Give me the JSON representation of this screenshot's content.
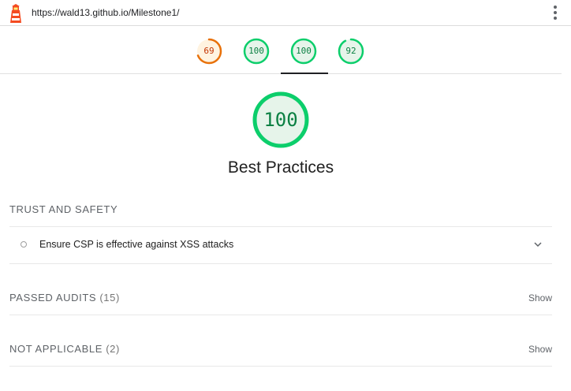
{
  "topbar": {
    "url": "https://wald13.github.io/Milestone1/",
    "logo_icon": "lighthouse-icon",
    "menu_icon": "more-vert-icon"
  },
  "gauges": [
    {
      "label": "69",
      "score": 0.69,
      "color": "#e8710a",
      "bg": "#fff3e0"
    },
    {
      "label": "100",
      "score": 1.0,
      "color": "#0cce6b",
      "bg": "#e6f4ea"
    },
    {
      "label": "100",
      "score": 1.0,
      "color": "#0cce6b",
      "bg": "#e6f4ea"
    },
    {
      "label": "92",
      "score": 0.92,
      "color": "#0cce6b",
      "bg": "#e6f4ea"
    }
  ],
  "category": {
    "score_label": "100",
    "score": 1.0,
    "title": "Best Practices",
    "color": "#0cce6b"
  },
  "sections": {
    "trust": {
      "title": "TRUST AND SAFETY",
      "audits": [
        {
          "title": "Ensure CSP is effective against XSS attacks",
          "icon": "info-circle-icon"
        }
      ]
    },
    "passed": {
      "title": "PASSED AUDITS",
      "count": "(15)",
      "show_label": "Show"
    },
    "not_applicable": {
      "title": "NOT APPLICABLE",
      "count": "(2)",
      "show_label": "Show"
    }
  }
}
